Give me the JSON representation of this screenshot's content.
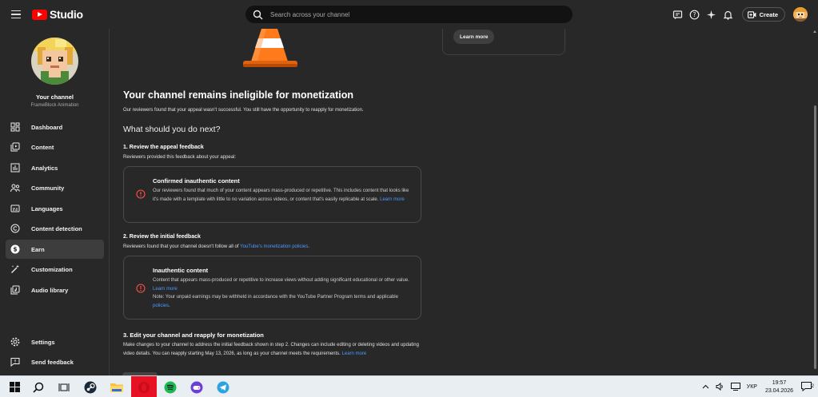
{
  "header": {
    "logo_text": "Studio",
    "search_placeholder": "Search across your channel",
    "create_label": "Create"
  },
  "sidebar": {
    "channel_title": "Your channel",
    "channel_name": "FrameBlock Animation",
    "items": [
      {
        "label": "Dashboard",
        "icon": "dashboard-icon"
      },
      {
        "label": "Content",
        "icon": "content-icon"
      },
      {
        "label": "Analytics",
        "icon": "analytics-icon"
      },
      {
        "label": "Community",
        "icon": "community-icon"
      },
      {
        "label": "Languages",
        "icon": "languages-icon"
      },
      {
        "label": "Content detection",
        "icon": "copyright-icon"
      },
      {
        "label": "Earn",
        "icon": "earn-icon",
        "active": true
      },
      {
        "label": "Customization",
        "icon": "customization-icon"
      },
      {
        "label": "Audio library",
        "icon": "audio-library-icon"
      }
    ],
    "bottom_items": [
      {
        "label": "Settings",
        "icon": "gear-icon"
      },
      {
        "label": "Send feedback",
        "icon": "feedback-icon"
      }
    ]
  },
  "main": {
    "top_card_button": "Learn more",
    "title": "Your channel remains ineligible for monetization",
    "subtitle": "Our reviewers found that your appeal wasn't successful. You still have the opportunity to reapply for monetization.",
    "next_heading": "What should you do next?",
    "step1": {
      "title": "1. Review the appeal feedback",
      "desc": "Reviewers provided this feedback about your appeal:",
      "box_title": "Confirmed inauthentic content",
      "box_body": "Our reviewers found that much of your content appears mass-produced or repetitive. This includes content that looks like it's made with a template with little to no variation across videos, or content that's easily replicable at scale.",
      "box_link": "Learn more"
    },
    "step2": {
      "title": "2. Review the initial feedback",
      "desc": "Reviewers found that your channel doesn't follow all of",
      "desc_link": "YouTube's monetization policies",
      "desc_end": ".",
      "box_title": "Inauthentic content",
      "box_body": "Content that appears mass-produced or repetitive to increase views without adding significant educational or other value.",
      "box_link": "Learn more",
      "note": "Note: Your unpaid earnings may be withheld in accordance with the YouTube Partner Program terms and applicable",
      "note_link": "policies",
      "note_end": "."
    },
    "step3": {
      "title": "3. Edit your channel and reapply for monetization",
      "body": "Make changes to your channel to address the initial feedback shown in step 2. Changes can include editing or deleting videos and updating video details. You can reapply starting May 13, 2026, as long as your channel meets the requirements.",
      "link": "Learn more"
    }
  },
  "taskbar": {
    "lang": "УКР",
    "time": "19:57",
    "date": "23.04.2026",
    "notification_count": "2"
  },
  "colors": {
    "accent_red": "#ff0000",
    "link_blue": "#4c9aff",
    "error_red": "#ff4e45",
    "bg_panel": "#282828"
  }
}
